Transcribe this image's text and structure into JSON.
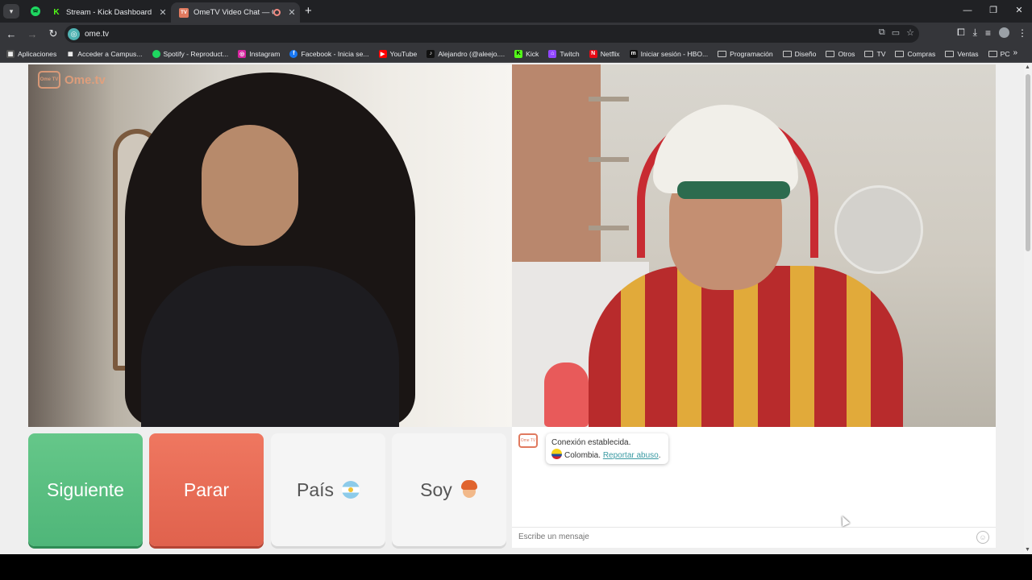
{
  "tabs": [
    {
      "label": "Stream - Kick Dashboard",
      "active": false,
      "favicon": "kick-icon"
    },
    {
      "label": "OmeTV Video Chat — Ome",
      "active": true,
      "favicon": "ometv-icon"
    }
  ],
  "address_bar": {
    "url": "ome.tv"
  },
  "bookmarks": [
    {
      "label": "Aplicaciones",
      "icon": "apps-grid-icon"
    },
    {
      "label": "Acceder a Campus...",
      "icon": "campus-icon"
    },
    {
      "label": "Spotify - Reproduct...",
      "icon": "spotify-icon"
    },
    {
      "label": "Instagram",
      "icon": "instagram-icon"
    },
    {
      "label": "Facebook - Inicia se...",
      "icon": "facebook-icon"
    },
    {
      "label": "YouTube",
      "icon": "youtube-icon"
    },
    {
      "label": "Alejandro (@aleejo....",
      "icon": "tiktok-icon"
    },
    {
      "label": "Kick",
      "icon": "kick-icon"
    },
    {
      "label": "Twitch",
      "icon": "twitch-icon"
    },
    {
      "label": "Netflix",
      "icon": "netflix-icon"
    },
    {
      "label": "Iniciar sesión - HBO...",
      "icon": "hbo-icon"
    },
    {
      "label": "Programación",
      "icon": "folder-icon"
    },
    {
      "label": "Diseño",
      "icon": "folder-icon"
    },
    {
      "label": "Otros",
      "icon": "folder-icon"
    },
    {
      "label": "TV",
      "icon": "folder-icon"
    },
    {
      "label": "Compras",
      "icon": "folder-icon"
    },
    {
      "label": "Ventas",
      "icon": "folder-icon"
    },
    {
      "label": "PC",
      "icon": "folder-icon"
    }
  ],
  "site": {
    "logo_text": "Ome.tv",
    "logo_small": "Ome TV",
    "buttons": {
      "next": "Siguiente",
      "stop": "Parar",
      "country": "País",
      "gender": "Soy"
    },
    "chat": {
      "status": "Conexión establecida.",
      "country": "Colombia.",
      "report": "Reportar abuso",
      "report_suffix": ".",
      "placeholder": "Escribe un mensaje"
    }
  },
  "colors": {
    "next_button": "#55bb7d",
    "stop_button": "#e8684f",
    "link": "#3b9aa3"
  }
}
